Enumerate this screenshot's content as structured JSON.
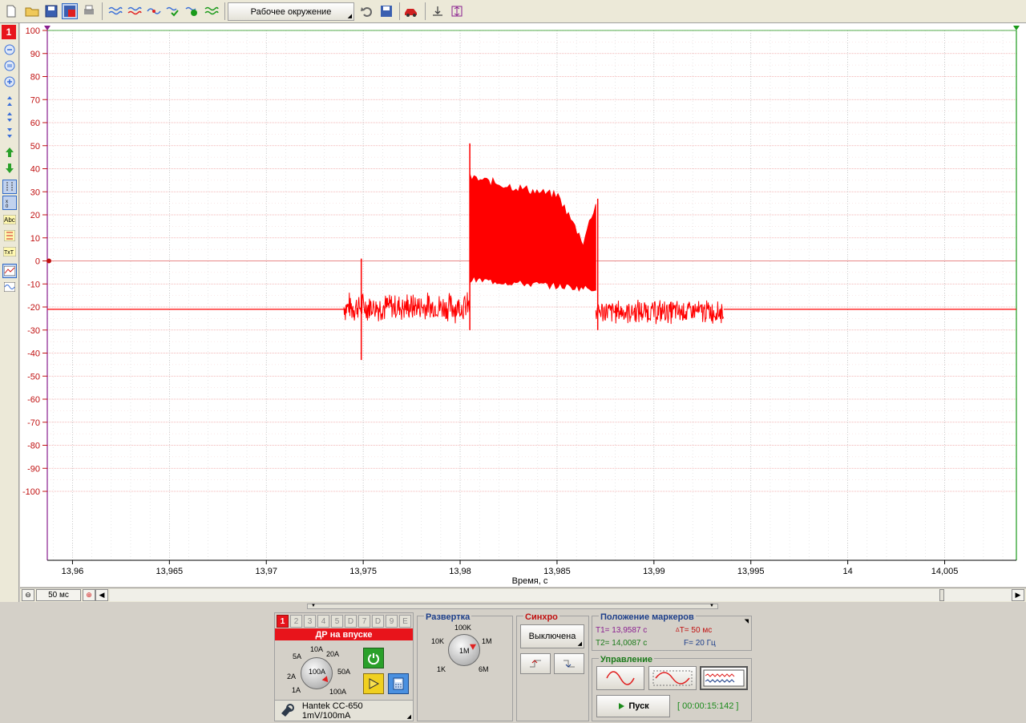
{
  "toolbar": {
    "environment_label": "Рабочее окружение"
  },
  "left_toolbar": {
    "channel_label": "1"
  },
  "chart_data": {
    "type": "line",
    "ylim": [
      -100,
      100
    ],
    "y_ticks": [
      100,
      90,
      80,
      70,
      60,
      50,
      40,
      30,
      20,
      10,
      0,
      -10,
      -20,
      -30,
      -40,
      -50,
      -60,
      -70,
      -80,
      -90,
      -100
    ],
    "xlim": [
      13.9587,
      14.0087
    ],
    "x_ticks": [
      "13,96",
      "13,965",
      "13,97",
      "13,975",
      "13,98",
      "13,985",
      "13,99",
      "13,995",
      "14",
      "14,005"
    ],
    "x_tick_values": [
      13.96,
      13.965,
      13.97,
      13.975,
      13.98,
      13.985,
      13.99,
      13.995,
      14.0,
      14.005
    ],
    "xlabel": "Время, с",
    "grid": true,
    "series": [
      {
        "color": "#ff0000",
        "segments": [
          {
            "x": [
              13.9587,
              13.974
            ],
            "y": [
              -21,
              -21
            ],
            "noise": 0.3
          },
          {
            "x": [
              13.974,
              13.9805
            ],
            "y": [
              -20,
              -20
            ],
            "noise": 6
          },
          {
            "x": [
              13.9805,
              13.987
            ],
            "y": [
              -8,
              -12
            ],
            "upper": [
              36,
              28,
              8
            ],
            "noise": 0
          },
          {
            "x": [
              13.987,
              13.9936
            ],
            "y": [
              -22,
              -22
            ],
            "noise": 5
          },
          {
            "x": [
              13.9936,
              14.0087
            ],
            "y": [
              -21,
              -21
            ],
            "noise": 0.3
          }
        ],
        "spikes": [
          {
            "x": 13.9749,
            "min": -43,
            "max": 1
          },
          {
            "x": 13.9805,
            "min": -30,
            "max": 51
          },
          {
            "x": 13.9871,
            "min": -30,
            "max": 27
          }
        ]
      }
    ]
  },
  "scale": {
    "timebase": "50 мс"
  },
  "channel_panel": {
    "tabs": [
      "1",
      "2",
      "3",
      "4",
      "5",
      "D",
      "7",
      "D",
      "9",
      "E"
    ],
    "title": "ДР на впуске",
    "knob_labels": [
      "10A",
      "20A",
      "5A",
      "50A",
      "2A",
      "1A",
      "100A",
      "100A"
    ],
    "probe": "Hantek CC-650 1mV/100mA"
  },
  "sweep_panel": {
    "title": "Развертка",
    "knob_labels": [
      "100K",
      "10K",
      "1M",
      "1K",
      "6M",
      "1M"
    ]
  },
  "sync_panel": {
    "title": "Синхро",
    "mode": "Выключена"
  },
  "markers_panel": {
    "title": "Положение маркеров",
    "t1": "T1= 13,9587 с",
    "t2": "T2= 14,0087 с",
    "dt": "T= 50 мс",
    "freq": "F= 20 Гц"
  },
  "control_panel": {
    "title": "Управление",
    "start_label": "Пуск",
    "timer": "[ 00:00:15:142 ]"
  }
}
